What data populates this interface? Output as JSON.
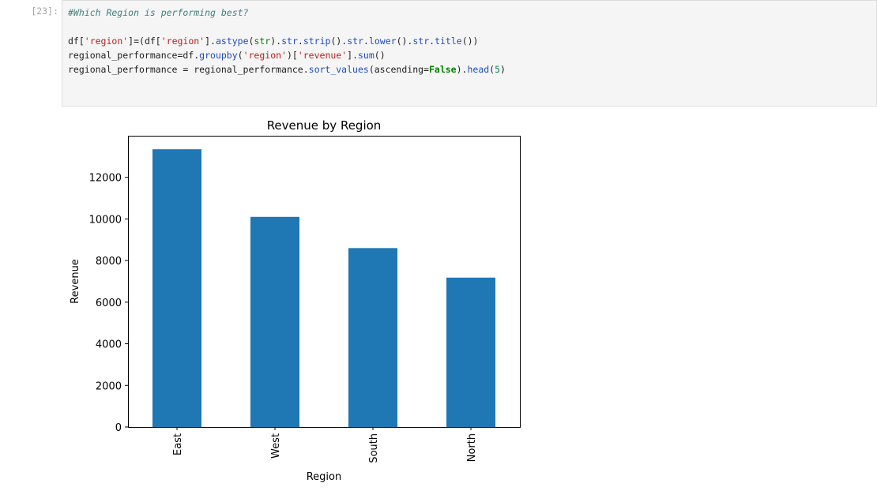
{
  "cell": {
    "prompt": "[23]:",
    "comment": "#Which Region is performing best?",
    "code": {
      "l1": {
        "a": "df[",
        "b": "'region'",
        "c": "]=(df[",
        "d": "'region'",
        "e": "].",
        "f": "astype",
        "g": "(",
        "h": "str",
        "i": ").",
        "j": "str",
        "k": ".",
        "l": "strip",
        "m": "().",
        "n": "str",
        "o": ".",
        "p": "lower",
        "q": "().",
        "r": "str",
        "s": ".",
        "t": "title",
        "u": "())"
      },
      "l2": {
        "a": "regional_performance=df.",
        "b": "groupby",
        "c": "(",
        "d": "'region'",
        "e": ")[",
        "f": "'revenue'",
        "g": "].",
        "h": "sum",
        "i": "()"
      },
      "l3": {
        "a": "regional_performance = regional_performance.",
        "b": "sort_values",
        "c": "(ascending=",
        "d": "False",
        "e": ").",
        "f": "head",
        "g": "(",
        "h": "5",
        "i": ")"
      }
    }
  },
  "colors": {
    "bar": "#1f77b4"
  },
  "chart_data": {
    "type": "bar",
    "title": "Revenue by Region",
    "xlabel": "Region",
    "ylabel": "Revenue",
    "categories": [
      "East",
      "West",
      "South",
      "North"
    ],
    "values": [
      13350,
      10100,
      8600,
      7180
    ],
    "ylim": [
      0,
      14000
    ],
    "yticks": [
      0,
      2000,
      4000,
      6000,
      8000,
      10000,
      12000
    ],
    "ytick_labels": [
      "0",
      "2000",
      "4000",
      "6000",
      "8000",
      "10000",
      "12000"
    ],
    "grid": false,
    "xtick_rotation": "vertical"
  }
}
